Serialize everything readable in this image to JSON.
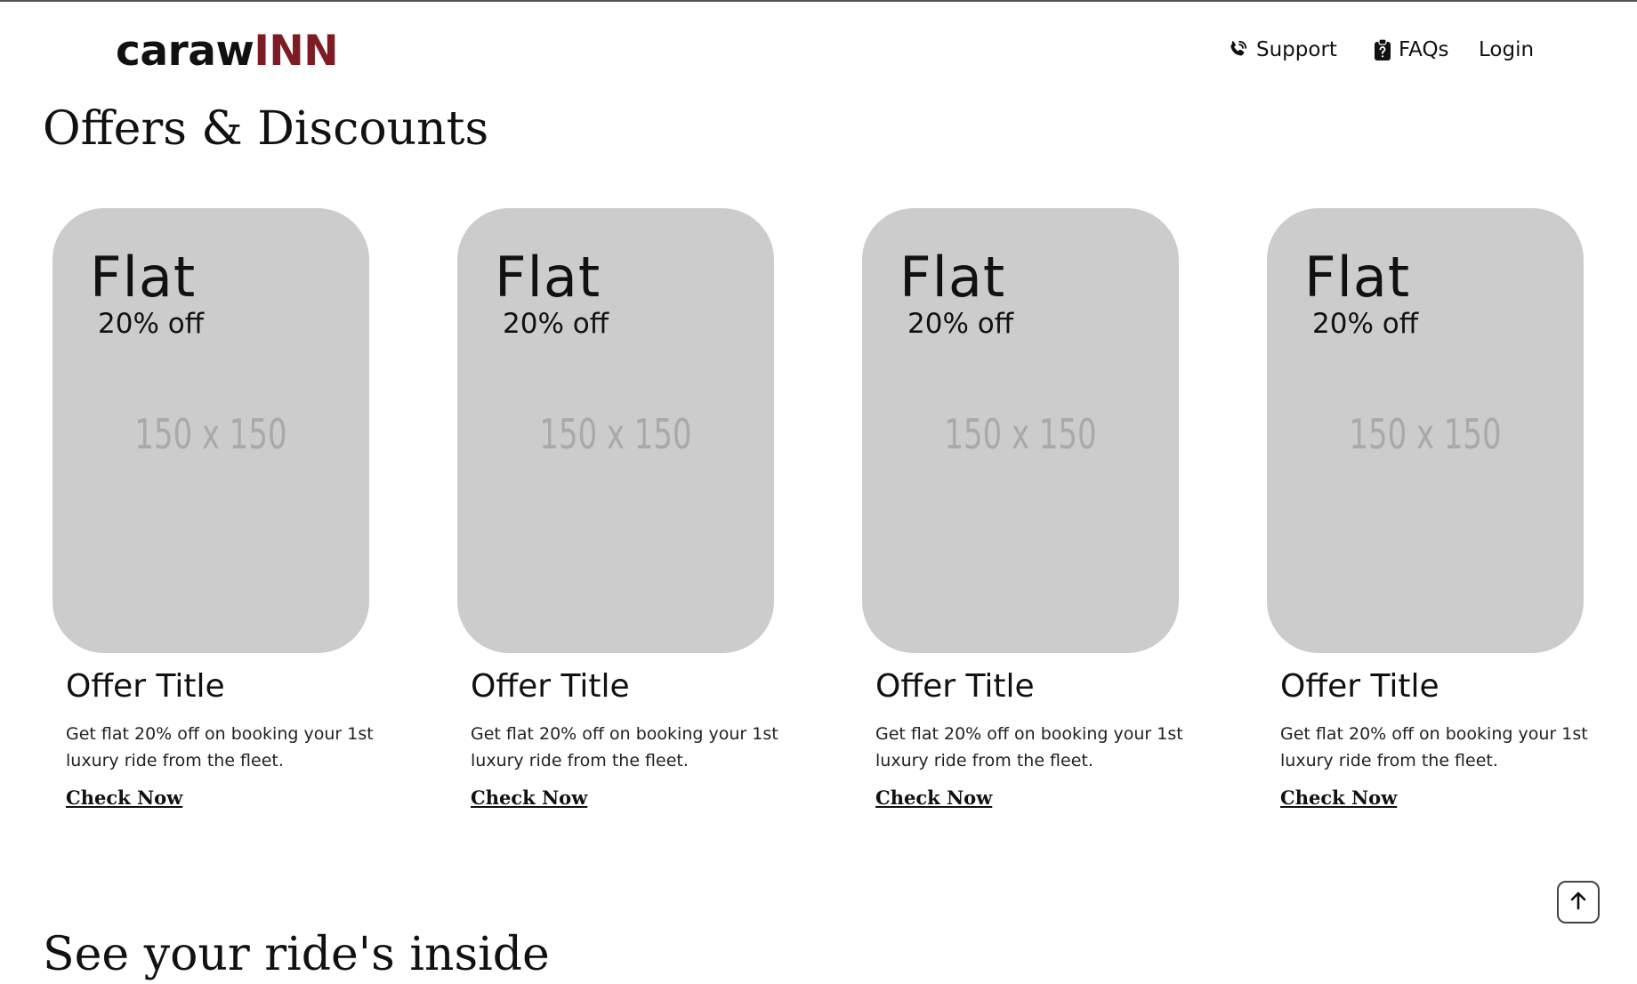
{
  "brand": {
    "prefix": "caraw",
    "accent": "INN",
    "accent_color": "#7d1c24"
  },
  "nav": {
    "support": {
      "label": "Support",
      "icon": "phone-icon"
    },
    "faqs": {
      "label": "FAQs",
      "icon": "clipboard-question-icon"
    },
    "login": {
      "label": "Login"
    }
  },
  "offers_section": {
    "title": "Offers & Discounts"
  },
  "offers": [
    {
      "flat": "Flat",
      "pct": "20% off",
      "placeholder": "150 x 150",
      "title": "Offer Title",
      "desc": "Get flat 20% off on booking your 1st luxury ride from the fleet.",
      "link": "Check Now"
    },
    {
      "flat": "Flat",
      "pct": "20% off",
      "placeholder": "150 x 150",
      "title": "Offer Title",
      "desc": "Get flat 20% off on booking your 1st luxury ride from the fleet.",
      "link": "Check Now"
    },
    {
      "flat": "Flat",
      "pct": "20% off",
      "placeholder": "150 x 150",
      "title": "Offer Title",
      "desc": "Get flat 20% off on booking your 1st luxury ride from the fleet.",
      "link": "Check Now"
    },
    {
      "flat": "Flat",
      "pct": "20% off",
      "placeholder": "150 x 150",
      "title": "Offer Title",
      "desc": "Get flat 20% off on booking your 1st luxury ride from the fleet.",
      "link": "Check Now"
    }
  ],
  "ride_section": {
    "title": "See your ride's inside"
  },
  "scroll_top": {
    "icon": "arrow-up-icon"
  }
}
